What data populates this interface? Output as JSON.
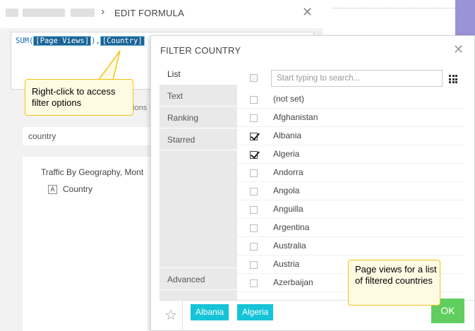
{
  "edit_formula": {
    "title": "EDIT FORMULA",
    "close_glyph": "✕",
    "breadcrumb_separator": "›",
    "formula": {
      "prefix": "SUM(",
      "token1": "[Page Views]",
      "sep": "),",
      "token2": "[Country]"
    },
    "suggestions_partial": "tions",
    "search_value": "country",
    "tree_title": "Traffic By Geography, Mont",
    "tree_node_icon": "A",
    "tree_node_label": "Country"
  },
  "callouts": {
    "right_click": "Right-click to access filter options",
    "page_views": "Page views for a list of filtered countries"
  },
  "filter_dialog": {
    "title": "FILTER COUNTRY",
    "close_glyph": "✕",
    "tabs": {
      "list": "List",
      "text": "Text",
      "ranking": "Ranking",
      "starred": "Starred",
      "advanced": "Advanced"
    },
    "search_placeholder": "Start typing to search...",
    "countries": [
      {
        "name": "(not set)",
        "checked": false
      },
      {
        "name": "Afghanistan",
        "checked": false
      },
      {
        "name": "Albania",
        "checked": true
      },
      {
        "name": "Algeria",
        "checked": true
      },
      {
        "name": "Andorra",
        "checked": false
      },
      {
        "name": "Angola",
        "checked": false
      },
      {
        "name": "Anguilla",
        "checked": false
      },
      {
        "name": "Argentina",
        "checked": false
      },
      {
        "name": "Australia",
        "checked": false
      },
      {
        "name": "Austria",
        "checked": false
      },
      {
        "name": "Azerbaijan",
        "checked": false
      }
    ],
    "selected_chips": [
      "Albania",
      "Algeria"
    ],
    "star_glyph": "☆",
    "ok_label": "OK"
  },
  "colors": {
    "chip": "#17c3d6",
    "ok_button": "#5fce5f",
    "callout_border": "#f0c419",
    "callout_fill": "#fffbe3",
    "token_bg": "#1a6496",
    "accent_strip": "#9b93d8"
  }
}
